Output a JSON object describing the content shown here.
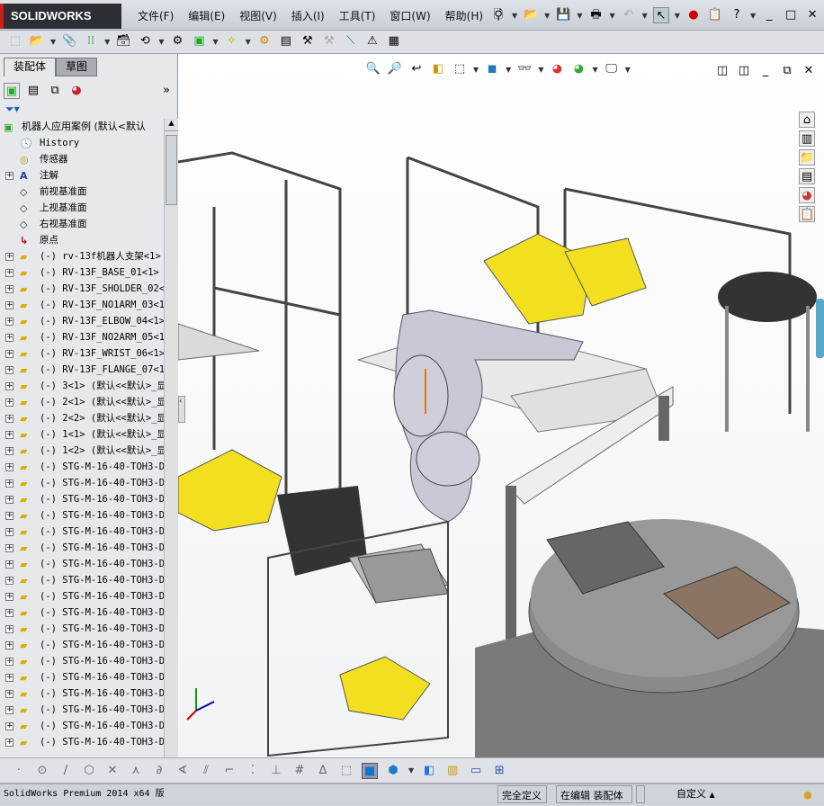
{
  "app": {
    "logo": "SOLIDWORKS",
    "menu": [
      "文件(F)",
      "编辑(E)",
      "视图(V)",
      "插入(I)",
      "工具(T)",
      "窗口(W)",
      "帮助(H)"
    ]
  },
  "panel": {
    "tabs": [
      "装配体",
      "草图"
    ],
    "active_tab": "装配体"
  },
  "tree": {
    "root": "机器人应用案例  (默认<默认",
    "items": [
      {
        "label": "History",
        "icon": "history-folder-icon",
        "expand": false
      },
      {
        "label": "传感器",
        "icon": "sensor-folder-icon",
        "expand": false
      },
      {
        "label": "注解",
        "icon": "annotation-folder-icon",
        "expand": true
      },
      {
        "label": "前视基准面",
        "icon": "plane-icon",
        "expand": false
      },
      {
        "label": "上视基准面",
        "icon": "plane-icon",
        "expand": false
      },
      {
        "label": "右视基准面",
        "icon": "plane-icon",
        "expand": false
      },
      {
        "label": "原点",
        "icon": "origin-icon",
        "expand": false
      },
      {
        "label": "(-) rv-13f机器人支架<1>",
        "icon": "component-icon",
        "expand": true
      },
      {
        "label": "(-) RV-13F_BASE_01<1> (",
        "icon": "component-icon",
        "expand": true
      },
      {
        "label": "(-) RV-13F_SHOLDER_02<1",
        "icon": "component-icon",
        "expand": true
      },
      {
        "label": "(-) RV-13F_NO1ARM_03<1>",
        "icon": "component-icon",
        "expand": true
      },
      {
        "label": "(-) RV-13F_ELBOW_04<1>",
        "icon": "component-icon",
        "expand": true
      },
      {
        "label": "(-) RV-13F_NO2ARM_05<1>",
        "icon": "component-icon",
        "expand": true
      },
      {
        "label": "(-) RV-13F_WRIST_06<1>",
        "icon": "component-icon",
        "expand": true
      },
      {
        "label": "(-) RV-13F_FLANGE_07<1>",
        "icon": "component-icon",
        "expand": true
      },
      {
        "label": "(-) 3<1> (默认<<默认>_显",
        "icon": "component-icon",
        "expand": true
      },
      {
        "label": "(-) 2<1> (默认<<默认>_显",
        "icon": "component-icon",
        "expand": true
      },
      {
        "label": "(-) 2<2> (默认<<默认>_显",
        "icon": "component-icon",
        "expand": true
      },
      {
        "label": "(-) 1<1> (默认<<默认>_显",
        "icon": "component-icon",
        "expand": true
      },
      {
        "label": "(-) 1<2> (默认<<默认>_显",
        "icon": "component-icon",
        "expand": true
      },
      {
        "label": "(-) STG-M-16-40-TOH3-D_",
        "icon": "component-icon",
        "expand": true
      },
      {
        "label": "(-) STG-M-16-40-TOH3-D_",
        "icon": "component-icon",
        "expand": true
      },
      {
        "label": "(-) STG-M-16-40-TOH3-D_",
        "icon": "component-icon",
        "expand": true
      },
      {
        "label": "(-) STG-M-16-40-TOH3-D_",
        "icon": "component-icon",
        "expand": true
      },
      {
        "label": "(-) STG-M-16-40-TOH3-D_",
        "icon": "component-icon",
        "expand": true
      },
      {
        "label": "(-) STG-M-16-40-TOH3-D_",
        "icon": "component-icon",
        "expand": true
      },
      {
        "label": "(-) STG-M-16-40-TOH3-D_",
        "icon": "component-icon",
        "expand": true
      },
      {
        "label": "(-) STG-M-16-40-TOH3-D_",
        "icon": "component-icon",
        "expand": true
      },
      {
        "label": "(-) STG-M-16-40-TOH3-D_",
        "icon": "component-icon",
        "expand": true
      },
      {
        "label": "(-) STG-M-16-40-TOH3-D_",
        "icon": "component-icon",
        "expand": true
      },
      {
        "label": "(-) STG-M-16-40-TOH3-D_",
        "icon": "component-icon",
        "expand": true
      },
      {
        "label": "(-) STG-M-16-40-TOH3-D_",
        "icon": "component-icon",
        "expand": true
      },
      {
        "label": "(-) STG-M-16-40-TOH3-D_",
        "icon": "component-icon",
        "expand": true
      },
      {
        "label": "(-) STG-M-16-40-TOH3-D_",
        "icon": "component-icon",
        "expand": true
      },
      {
        "label": "(-) STG-M-16-40-TOH3-D_",
        "icon": "component-icon",
        "expand": true
      },
      {
        "label": "(-) STG-M-16-40-TOH3-D_",
        "icon": "component-icon",
        "expand": true
      },
      {
        "label": "(-) STG-M-16-40-TOH3-D_",
        "icon": "component-icon",
        "expand": true
      },
      {
        "label": "(-) STG-M-16-40-TOH3-D_",
        "icon": "component-icon",
        "expand": true
      }
    ]
  },
  "status": {
    "product": "SolidWorks Premium 2014 x64 版",
    "state": "完全定义",
    "mode": "在编辑 装配体",
    "units": "自定义"
  },
  "colors": {
    "bin_yellow": "#f2e020",
    "frame": "#d8dadc",
    "accent_red": "#c8201f"
  }
}
